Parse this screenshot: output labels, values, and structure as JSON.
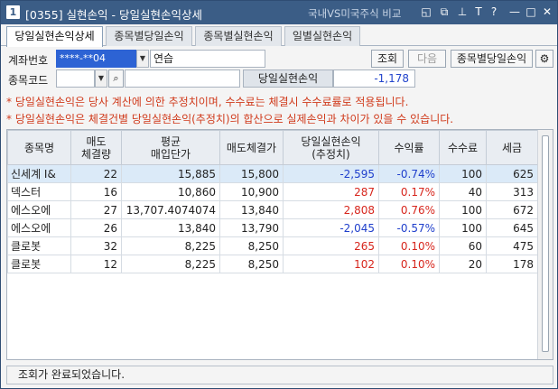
{
  "window": {
    "number": "1",
    "title": "[0355] 실현손익 - 당일실현손익상세",
    "compare_link": "국내VS미국주식 비교"
  },
  "tabs": [
    {
      "label": "당일실현손익상세",
      "active": true
    },
    {
      "label": "종목별당일손익",
      "active": false
    },
    {
      "label": "종목별실현손익",
      "active": false
    },
    {
      "label": "일별실현손익",
      "active": false
    }
  ],
  "form": {
    "account_label": "계좌번호",
    "account_value": "****-**04",
    "account_name": "연습",
    "code_label": "종목코드",
    "code_value": "",
    "code_name": "",
    "search_button": "조회",
    "next_button": "다음",
    "stock_daily_button": "종목별당일손익",
    "summary_label": "당일실현손익",
    "summary_value": "-1,178"
  },
  "notes": [
    "* 당일실현손익은 당사 계산에 의한 추정치이며, 수수료는 체결시 수수료률로 적용됩니다.",
    "* 당일실현손익은 체결건별 당일실현손익(추정치)의 합산으로 실제손익과 차이가 있을 수 있습니다."
  ],
  "table": {
    "headers": [
      {
        "l1": "종목명",
        "l2": ""
      },
      {
        "l1": "매도",
        "l2": "체결량"
      },
      {
        "l1": "평균",
        "l2": "매입단가"
      },
      {
        "l1": "매도체결가",
        "l2": ""
      },
      {
        "l1": "당일실현손익",
        "l2": "(추정치)"
      },
      {
        "l1": "수익률",
        "l2": ""
      },
      {
        "l1": "수수료",
        "l2": ""
      },
      {
        "l1": "세금",
        "l2": ""
      }
    ],
    "rows": [
      {
        "name": "신세계 I&",
        "qty": "22",
        "avg": "15,885",
        "sell": "15,800",
        "pnl": "-2,595",
        "rate": "-0.74%",
        "fee": "100",
        "tax": "625",
        "sign": "neg",
        "selected": true
      },
      {
        "name": "덱스터",
        "qty": "16",
        "avg": "10,860",
        "sell": "10,900",
        "pnl": "287",
        "rate": "0.17%",
        "fee": "40",
        "tax": "313",
        "sign": "pos",
        "selected": false
      },
      {
        "name": "에스오에",
        "qty": "27",
        "avg": "13,707.4074074",
        "sell": "13,840",
        "pnl": "2,808",
        "rate": "0.76%",
        "fee": "100",
        "tax": "672",
        "sign": "pos",
        "selected": false
      },
      {
        "name": "에스오에",
        "qty": "26",
        "avg": "13,840",
        "sell": "13,790",
        "pnl": "-2,045",
        "rate": "-0.57%",
        "fee": "100",
        "tax": "645",
        "sign": "neg",
        "selected": false
      },
      {
        "name": "클로봇",
        "qty": "32",
        "avg": "8,225",
        "sell": "8,250",
        "pnl": "265",
        "rate": "0.10%",
        "fee": "60",
        "tax": "475",
        "sign": "pos",
        "selected": false
      },
      {
        "name": "클로봇",
        "qty": "12",
        "avg": "8,225",
        "sell": "8,250",
        "pnl": "102",
        "rate": "0.10%",
        "fee": "20",
        "tax": "178",
        "sign": "pos",
        "selected": false
      }
    ]
  },
  "status": {
    "message": "조회가 완료되었습니다."
  },
  "colors": {
    "titlebar": "#3b5d86",
    "negative": "#1f3fcc",
    "positive": "#d7261d",
    "note": "#d03a1b",
    "selected_row": "#dbeaf8"
  }
}
